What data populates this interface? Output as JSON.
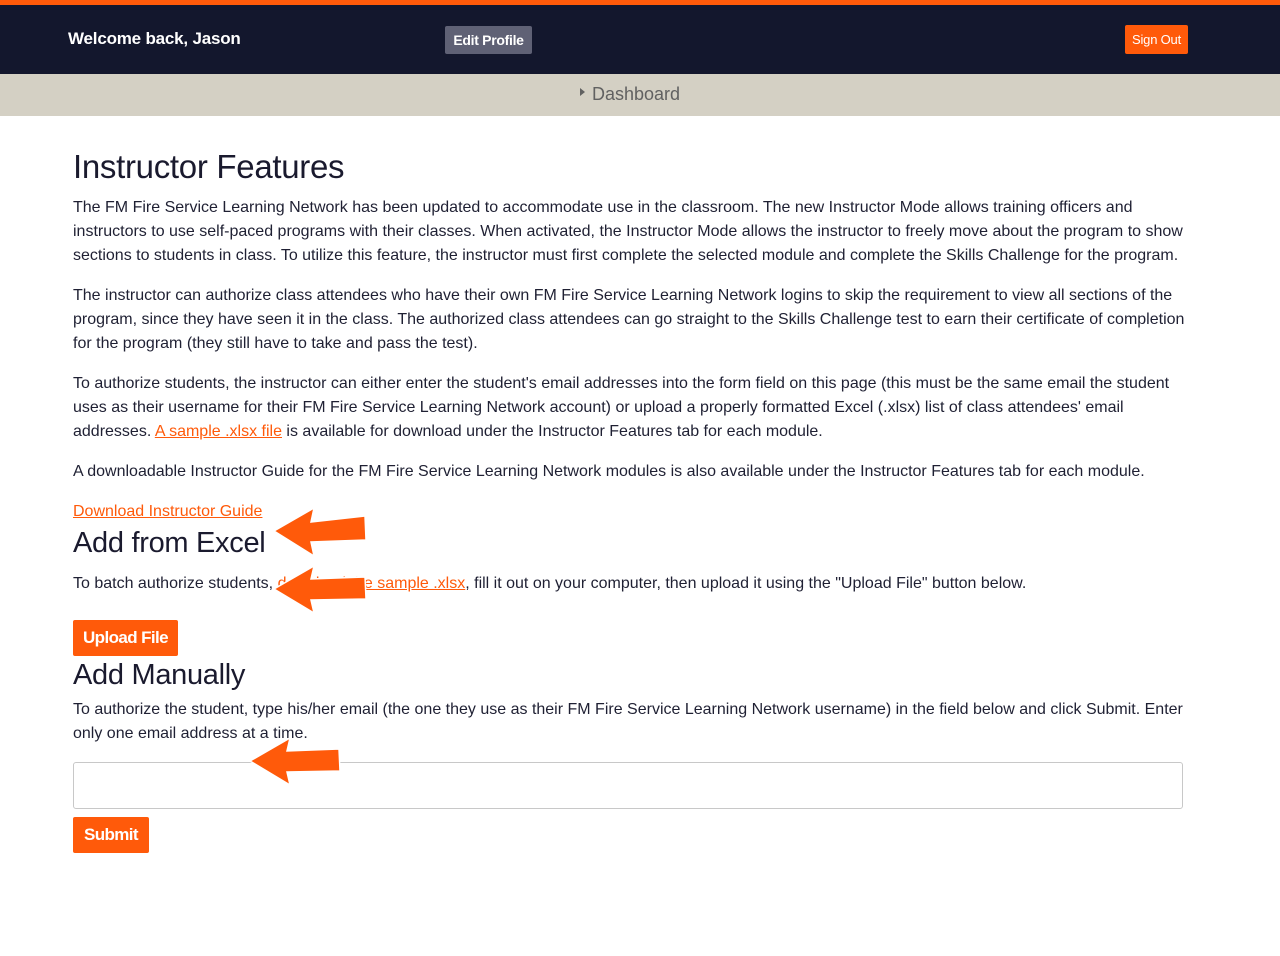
{
  "header": {
    "welcome": "Welcome back, Jason",
    "edit_profile_label": "Edit Profile",
    "sign_out_label": "Sign Out"
  },
  "breadcrumb": {
    "label": "Dashboard"
  },
  "main": {
    "title": "Instructor Features",
    "paragraph1": "The FM Fire Service Learning Network has been updated to accommodate use in the classroom. The new Instructor Mode allows training officers and instructors to use self-paced programs with their classes. When activated, the Instructor Mode allows the instructor to freely move about the program to show sections to students in class. To utilize this feature, the instructor must first complete the selected module and complete the Skills Challenge for the program.",
    "paragraph2": "The instructor can authorize class attendees who have their own FM Fire Service Learning Network logins to skip the requirement to view all sections of the program, since they have seen it in the class. The authorized class attendees can go straight to the Skills Challenge test to earn their certificate of completion for the program (they still have to take and pass the test).",
    "paragraph3_before": "To authorize students, the instructor can either enter the student's email addresses into the form field on this page (this must be the same email the student uses as their username for their FM Fire Service Learning Network account) or upload a properly formatted Excel (.xlsx) list of class attendees' email addresses. ",
    "paragraph3_link": "A sample .xlsx file",
    "paragraph3_after": " is available for download under the Instructor Features tab for each module.",
    "paragraph4": "A downloadable Instructor Guide for the FM Fire Service Learning Network modules is also available under the Instructor Features tab for each module.",
    "guide_link": "Download Instructor Guide"
  },
  "excel": {
    "heading": "Add from Excel",
    "text_before": "To batch authorize students, ",
    "text_link": "download the sample .xlsx",
    "text_after": ", fill it out on your computer, then upload it using the \"Upload File\" button below.",
    "upload_label": "Upload File"
  },
  "manual": {
    "heading": "Add Manually",
    "text": "To authorize the student, type his/her email (the one they use as their FM Fire Service Learning Network username) in the field below and click Submit. Enter only one email address at a time.",
    "email_value": "",
    "submit_label": "Submit"
  },
  "colors": {
    "accent": "#ff5a0a",
    "header_bg": "#13172d",
    "breadcrumb_bg": "#d4d0c4",
    "edit_profile_bg": "#5f6175"
  },
  "annotations": [
    {
      "icon": "orange-arrow-icon",
      "points_to": "Download Instructor Guide"
    },
    {
      "icon": "orange-arrow-icon",
      "points_to": "Add from Excel"
    },
    {
      "icon": "orange-arrow-icon",
      "points_to": "Add Manually"
    }
  ]
}
